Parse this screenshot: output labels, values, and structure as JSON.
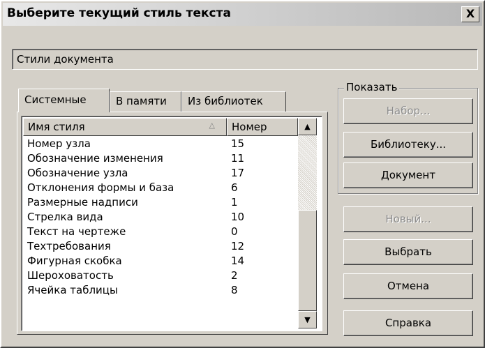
{
  "window": {
    "title": "Выберите текущий стиль текста",
    "close_label": "X"
  },
  "style_source": "Стили документа",
  "tabs": [
    {
      "label": "Системные",
      "active": true
    },
    {
      "label": "В памяти",
      "active": false
    },
    {
      "label": "Из библиотек",
      "active": false
    }
  ],
  "list": {
    "columns": {
      "name": "Имя стиля",
      "number": "Номер"
    },
    "sort_indicator": "△",
    "rows": [
      {
        "name": "Номер узла",
        "number": "15"
      },
      {
        "name": "Обозначение изменения",
        "number": "11"
      },
      {
        "name": "Обозначение узла",
        "number": "17"
      },
      {
        "name": "Отклонения формы и база",
        "number": "6"
      },
      {
        "name": "Размерные надписи",
        "number": "1"
      },
      {
        "name": "Стрелка вида",
        "number": "10"
      },
      {
        "name": "Текст на чертеже",
        "number": "0"
      },
      {
        "name": "Техтребования",
        "number": "12"
      },
      {
        "name": "Фигурная скобка",
        "number": "14"
      },
      {
        "name": "Шероховатость",
        "number": "2"
      },
      {
        "name": "Ячейка таблицы",
        "number": "8"
      }
    ],
    "scroll_up": "▲",
    "scroll_down": "▼"
  },
  "show_group": {
    "legend": "Показать",
    "set_label": "Набор...",
    "library_label": "Библиотеку...",
    "document_label": "Документ"
  },
  "buttons": {
    "new_label": "Новый...",
    "select_label": "Выбрать",
    "cancel_label": "Отмена",
    "help_label": "Справка"
  }
}
